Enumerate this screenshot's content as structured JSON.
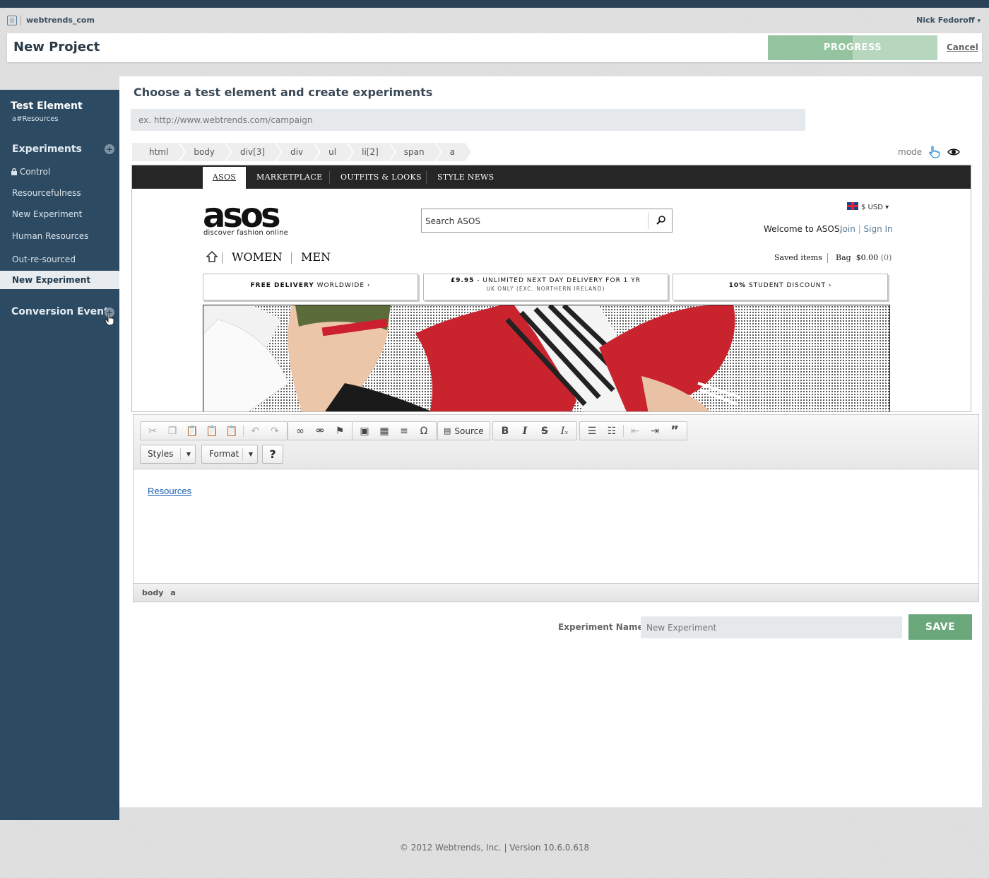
{
  "account": {
    "name": "webtrends_com",
    "user": "Nick Fedoroff",
    "user_caret": "▾"
  },
  "header": {
    "title": "New Project",
    "progress_label": "PROGRESS",
    "progress_fraction": 0.5,
    "cancel_label": "Cancel"
  },
  "sidebar": {
    "test_element_title": "Test Element",
    "test_element_value": "a#Resources",
    "experiments_title": "Experiments",
    "items": [
      {
        "label": "Control",
        "locked": true
      },
      {
        "label": "Resourcefulness"
      },
      {
        "label": "New Experiment"
      },
      {
        "label": "Human Resources"
      },
      {
        "label": "Out-re-sourced"
      },
      {
        "label": "New Experiment",
        "active": true
      }
    ],
    "conversion_title": "Conversion Event"
  },
  "main": {
    "title": "Choose a test element and create experiments",
    "url_placeholder": "ex. http://www.webtrends.com/campaign",
    "breadcrumbs": [
      "html",
      "body",
      "div[3]",
      "div",
      "ul",
      "li[2]",
      "span",
      "a"
    ],
    "mode_label": "mode"
  },
  "preview": {
    "nav_tabs": [
      "ASOS",
      "MARKETPLACE",
      "OUTFITS & LOOKS",
      "STYLE NEWS"
    ],
    "logo": "asos",
    "tagline": "discover fashion online",
    "search_placeholder": "Search ASOS",
    "currency": "$ USD",
    "welcome": "Welcome to ASOS.",
    "join": "Join",
    "signin": "Sign In",
    "women": "WOMEN",
    "men": "MEN",
    "saved_items": "Saved items",
    "bag": "Bag",
    "bag_amount": "$0.00",
    "bag_count": "(0)",
    "promos": [
      {
        "bold": "FREE DELIVERY",
        "text": " WORLDWIDE ›",
        "sub": ""
      },
      {
        "bold": "£9.95",
        "text": " - UNLIMITED NEXT DAY DELIVERY FOR 1 YR",
        "sub": "UK ONLY (EXC. NORTHERN IRELAND)"
      },
      {
        "bold": "10%",
        "text": " STUDENT DISCOUNT ›",
        "sub": ""
      }
    ]
  },
  "editor": {
    "source_label": "Source",
    "styles_label": "Styles",
    "format_label": "Format",
    "help_label": "?",
    "content_link": "Resources",
    "path_label": "body a"
  },
  "form": {
    "name_label": "Experiment Name",
    "name_placeholder": "New Experiment",
    "save_label": "SAVE"
  },
  "footer": {
    "text": "© 2012 Webtrends, Inc. | Version 10.6.0.618"
  },
  "colors": {
    "sidebar": "#2c4a62",
    "accent_green": "#6aa77a",
    "progress_fill": "#93c39f"
  }
}
